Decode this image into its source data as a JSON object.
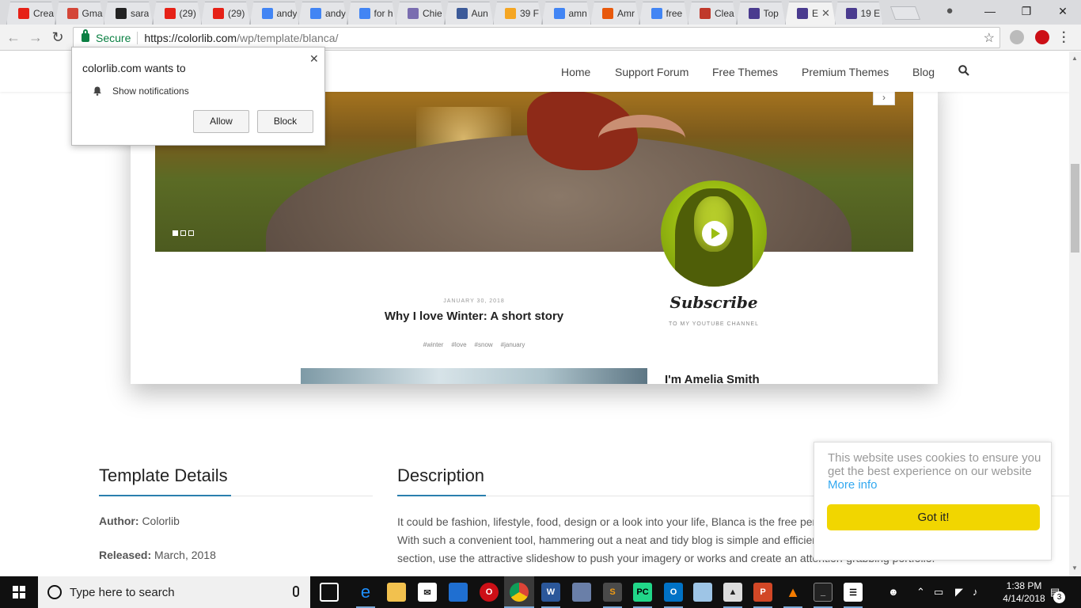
{
  "browser": {
    "tabs": [
      {
        "title": "Crea",
        "favicon": "youtube-icon",
        "color": "#e62117"
      },
      {
        "title": "Gma",
        "favicon": "gmail-icon",
        "color": "#d44638"
      },
      {
        "title": "sara",
        "favicon": "github-icon",
        "color": "#222222"
      },
      {
        "title": "(29)",
        "favicon": "youtube-icon",
        "color": "#e62117"
      },
      {
        "title": "(29)",
        "favicon": "youtube-icon",
        "color": "#e62117"
      },
      {
        "title": "andy",
        "favicon": "google-icon",
        "color": "#4285f4"
      },
      {
        "title": "andy",
        "favicon": "google-icon",
        "color": "#4285f4"
      },
      {
        "title": "for h",
        "favicon": "google-icon",
        "color": "#4285f4"
      },
      {
        "title": "Chie",
        "favicon": "guitar-icon",
        "color": "#7a6db0"
      },
      {
        "title": "Aun",
        "favicon": "s-icon",
        "color": "#3c5a99"
      },
      {
        "title": "39 F",
        "favicon": "her-icon",
        "color": "#f5a623"
      },
      {
        "title": "amn",
        "favicon": "google-icon",
        "color": "#4285f4"
      },
      {
        "title": "Amr",
        "favicon": "fire-icon",
        "color": "#e8590c"
      },
      {
        "title": "free",
        "favicon": "google-icon",
        "color": "#4285f4"
      },
      {
        "title": "Clea",
        "favicon": "s-icon",
        "color": "#c0392b"
      },
      {
        "title": "Top",
        "favicon": "colorlib-icon",
        "color": "#4a3b8f"
      },
      {
        "title": "E",
        "favicon": "colorlib-icon",
        "color": "#4a3b8f",
        "active": true
      },
      {
        "title": "19 E",
        "favicon": "colorlib-icon",
        "color": "#4a3b8f"
      }
    ],
    "secure_label": "Secure",
    "url_host": "https://colorlib.com",
    "url_path": "/wp/template/blanca/"
  },
  "notification": {
    "title": "colorlib.com wants to",
    "permission": "Show notifications",
    "allow_label": "Allow",
    "block_label": "Block"
  },
  "site_nav": {
    "items": [
      "Home",
      "Support Forum",
      "Free Themes",
      "Premium Themes",
      "Blog"
    ]
  },
  "preview": {
    "post_date": "JANUARY 30, 2018",
    "post_title": "Why I love Winter: A short story",
    "tags": [
      "#winter",
      "#love",
      "#snow",
      "#january"
    ],
    "subscribe": "Subscribe",
    "subscribe_sub": "TO MY YOUTUBE CHANNEL",
    "sidebar_heading": "I'm Amelia Smith"
  },
  "details": {
    "heading": "Template Details",
    "author_label": "Author:",
    "author_value": "Colorlib",
    "released_label": "Released:",
    "released_value": "March, 2018"
  },
  "description": {
    "heading": "Description",
    "line1": "It could be fashion, lifestyle, food, design or a look into your life, Blanca is the free per",
    "line2": "With such a convenient tool, hammering out a neat and tidy blog is simple and efficier",
    "line3": "section, use the attractive slideshow to push your imagery or works and create an attention-grabbing portfolio."
  },
  "cookie": {
    "message": "This website uses cookies to ensure you get the best experience on our website",
    "more_info": "More info",
    "button": "Got it!"
  },
  "taskbar": {
    "search_placeholder": "Type here to search",
    "time": "1:38 PM",
    "date": "4/14/2018",
    "notification_count": "3"
  }
}
